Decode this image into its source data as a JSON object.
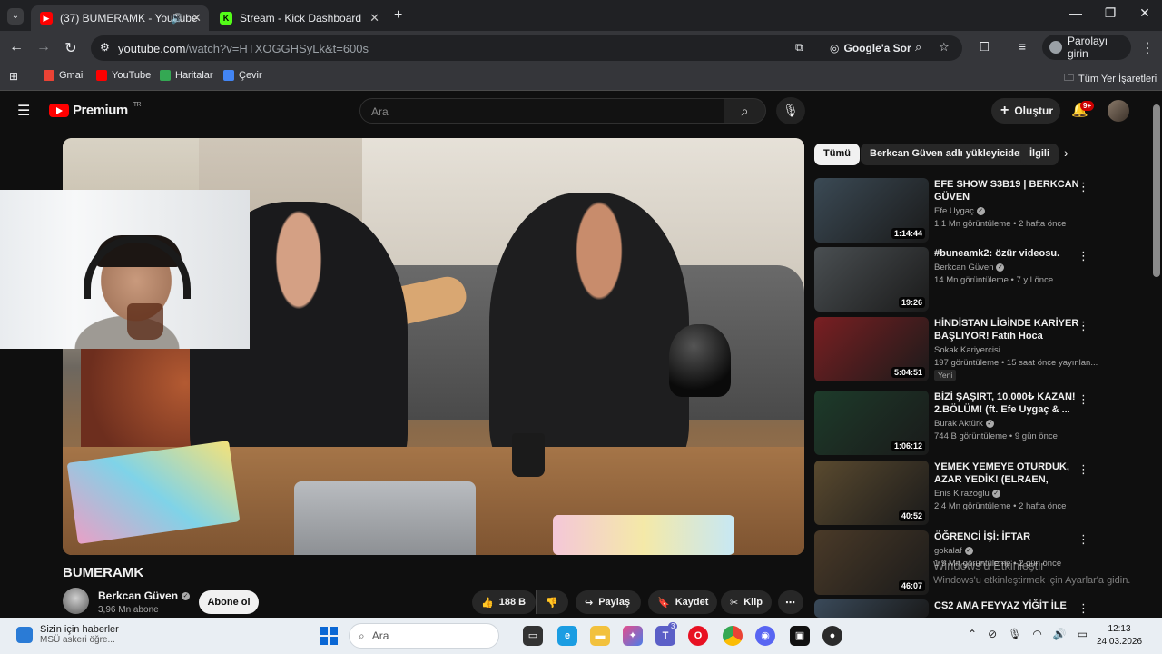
{
  "browser": {
    "tabs": [
      {
        "label": "(37) BUMERAMK - YouTube",
        "active": true,
        "favicon": "youtube-icon"
      },
      {
        "label": "Stream - Kick Dashboard",
        "active": false,
        "favicon": "kick-icon"
      }
    ],
    "url_host": "youtube.com",
    "url_path": "/watch?v=HTXOGGHSyLk&t=600s",
    "ask_google_label": "Google'a Sor",
    "profile_label": "Parolayı girin",
    "bookmarks": [
      "Gmail",
      "YouTube",
      "Haritalar",
      "Çevir"
    ],
    "all_bookmarks_label": "Tüm Yer İşaretleri"
  },
  "yt_header": {
    "logo_text": "Premium",
    "logo_region": "TR",
    "search_placeholder": "Ara",
    "create_label": "Oluştur",
    "notification_badge": "9+"
  },
  "video": {
    "title": "BUMERAMK",
    "channel_name": "Berkcan Güven",
    "subscribers": "3,96 Mn abone",
    "subscribe_label": "Abone ol",
    "like_count": "188 B",
    "share_label": "Paylaş",
    "save_label": "Kaydet",
    "clip_label": "Klip"
  },
  "chips": [
    "Tümü",
    "Berkcan Güven adlı yükleyiciden",
    "İlgili"
  ],
  "recommendations": [
    {
      "title": "EFE SHOW S3B19 | BERKCAN GÜVEN",
      "channel": "Efe Uygaç",
      "verified": true,
      "meta": "1,1 Mn görüntüleme • 2 hafta önce",
      "duration": "1:14:44",
      "thumb": "#3b4a55"
    },
    {
      "title": "#buneamk2: özür videosu.",
      "channel": "Berkcan Güven",
      "verified": true,
      "meta": "14 Mn görüntüleme • 7 yıl önce",
      "duration": "19:26",
      "thumb": "#4a4f52"
    },
    {
      "title": "HİNDİSTAN LİGİNDE KARİYER BAŞLIYOR! Fatih Hoca Kariyeri...",
      "channel": "Sokak Kariyercisi",
      "verified": false,
      "meta": "197 görüntüleme • 15 saat önce yayınlan...",
      "duration": "5:04:51",
      "badge": "Yeni",
      "thumb": "#7a1f22"
    },
    {
      "title": "BİZİ ŞAŞIRT, 10.000₺ KAZAN! 2.BÖLÜM! (ft. Efe Uygaç & ...",
      "channel": "Burak Aktürk",
      "verified": true,
      "meta": "744 B görüntüleme • 9 gün önce",
      "duration": "1:06:12",
      "thumb": "#1d3b2a"
    },
    {
      "title": "YEMEK YEMEYE OTURDUK, AZAR YEDİK! (ELRAEN, ERAY, ...",
      "channel": "Enis Kirazoglu",
      "verified": true,
      "meta": "2,4 Mn görüntüleme • 2 hafta önce",
      "duration": "40:52",
      "thumb": "#5a4a2f"
    },
    {
      "title": "ÖĞRENCİ İŞİ: İFTAR",
      "channel": "gokalaf",
      "verified": true,
      "meta": "1,9 Mn görüntüleme • 2 gün önce",
      "duration": "46:07",
      "thumb": "#4a3a28"
    },
    {
      "title": "CS2 AMA FEYYAZ YİĞİT İLE",
      "channel": "",
      "verified": false,
      "meta": "",
      "duration": "",
      "thumb": "#3a4a5a"
    }
  ],
  "windows_activation": {
    "line1": "Windows'u Etkinleştir",
    "line2": "Windows'u etkinleştirmek için Ayarlar'a gidin."
  },
  "taskbar": {
    "news_title": "Sizin için haberler",
    "news_sub": "MSÜ askeri öğre...",
    "search_placeholder": "Ara",
    "time": "12:13",
    "date": "24.03.2026",
    "teams_badge": "3"
  }
}
